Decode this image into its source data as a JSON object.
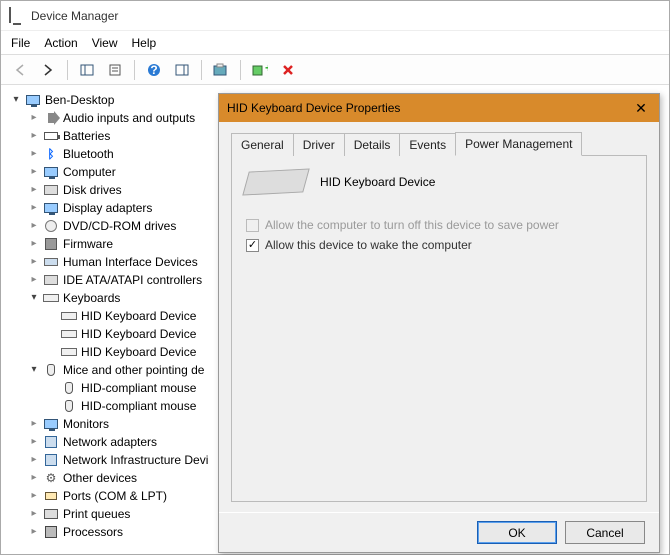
{
  "window": {
    "title": "Device Manager",
    "menus": [
      "File",
      "Action",
      "View",
      "Help"
    ]
  },
  "toolbar": {
    "back": "back-icon",
    "forward": "forward-icon",
    "show_hidden": "pane-icon",
    "properties": "properties-icon",
    "help": "help-icon",
    "action": "action-icon",
    "scan": "scan-icon",
    "add_legacy": "add-legacy-icon",
    "uninstall": "uninstall-icon"
  },
  "tree": {
    "root": "Ben-Desktop",
    "items": [
      {
        "label": "Audio inputs and outputs",
        "icon": "speaker"
      },
      {
        "label": "Batteries",
        "icon": "bat"
      },
      {
        "label": "Bluetooth",
        "icon": "bt"
      },
      {
        "label": "Computer",
        "icon": "monitor"
      },
      {
        "label": "Disk drives",
        "icon": "disk"
      },
      {
        "label": "Display adapters",
        "icon": "monitor"
      },
      {
        "label": "DVD/CD-ROM drives",
        "icon": "cd"
      },
      {
        "label": "Firmware",
        "icon": "chip"
      },
      {
        "label": "Human Interface Devices",
        "icon": "hid"
      },
      {
        "label": "IDE ATA/ATAPI controllers",
        "icon": "disk"
      },
      {
        "label": "Keyboards",
        "icon": "kbd",
        "expanded": true,
        "children": [
          {
            "label": "HID Keyboard Device",
            "icon": "kbd"
          },
          {
            "label": "HID Keyboard Device",
            "icon": "kbd"
          },
          {
            "label": "HID Keyboard Device",
            "icon": "kbd"
          }
        ]
      },
      {
        "label": "Mice and other pointing de",
        "icon": "mouse",
        "expanded": true,
        "children": [
          {
            "label": "HID-compliant mouse",
            "icon": "mouse"
          },
          {
            "label": "HID-compliant mouse",
            "icon": "mouse"
          }
        ]
      },
      {
        "label": "Monitors",
        "icon": "monitor"
      },
      {
        "label": "Network adapters",
        "icon": "net"
      },
      {
        "label": "Network Infrastructure Devi",
        "icon": "net"
      },
      {
        "label": "Other devices",
        "icon": "gear"
      },
      {
        "label": "Ports (COM & LPT)",
        "icon": "port"
      },
      {
        "label": "Print queues",
        "icon": "print"
      },
      {
        "label": "Processors",
        "icon": "cpu"
      }
    ]
  },
  "dialog": {
    "title": "HID Keyboard Device Properties",
    "tabs": [
      "General",
      "Driver",
      "Details",
      "Events",
      "Power Management"
    ],
    "active_tab": "Power Management",
    "device_name": "HID Keyboard Device",
    "option_turnoff": "Allow the computer to turn off this device to save power",
    "option_turnoff_checked": false,
    "option_turnoff_enabled": false,
    "option_wake": "Allow this device to wake the computer",
    "option_wake_checked": true,
    "ok_label": "OK",
    "cancel_label": "Cancel"
  }
}
